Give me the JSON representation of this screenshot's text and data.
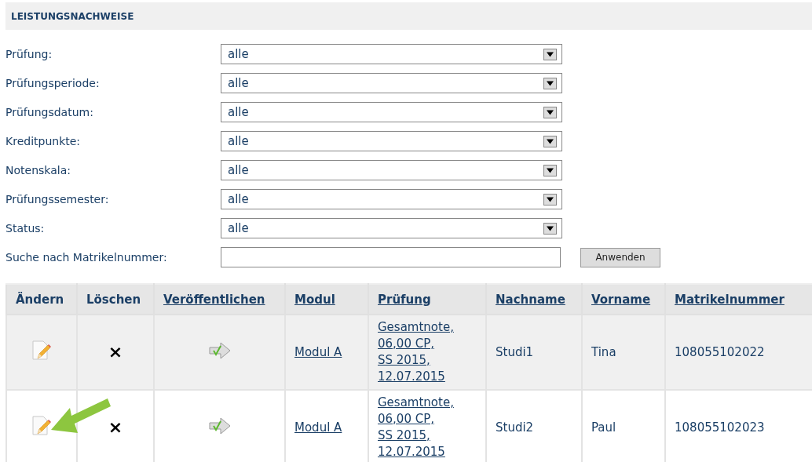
{
  "section_title": "LEISTUNGSNACHWEISE",
  "filters": [
    {
      "label": "Prüfung:",
      "value": "alle"
    },
    {
      "label": "Prüfungsperiode:",
      "value": "alle"
    },
    {
      "label": "Prüfungsdatum:",
      "value": "alle"
    },
    {
      "label": "Kreditpunkte:",
      "value": "alle"
    },
    {
      "label": "Notenskala:",
      "value": "alle"
    },
    {
      "label": "Prüfungssemester:",
      "value": "alle"
    },
    {
      "label": "Status:",
      "value": "alle"
    }
  ],
  "search": {
    "label": "Suche nach Matrikelnummer:",
    "apply_button": "Anwenden"
  },
  "table": {
    "columns": [
      {
        "label": "Ändern",
        "sortable": false
      },
      {
        "label": "Löschen",
        "sortable": false
      },
      {
        "label": "Veröffentlichen",
        "sortable": true
      },
      {
        "label": "Modul",
        "sortable": true
      },
      {
        "label": "Prüfung",
        "sortable": true
      },
      {
        "label": "Nachname",
        "sortable": true
      },
      {
        "label": "Vorname",
        "sortable": true
      },
      {
        "label": "Matrikelnummer",
        "sortable": true
      }
    ],
    "rows": [
      {
        "delete": "×",
        "modul": "Modul A",
        "pruefung": [
          "Gesamtnote,",
          "06,00 CP,",
          "SS 2015,",
          "12.07.2015"
        ],
        "nachname": "Studi1",
        "vorname": "Tina",
        "matrikelnummer": "108055102022",
        "pointed_at": false
      },
      {
        "delete": "×",
        "modul": "Modul A",
        "pruefung": [
          "Gesamtnote,",
          "06,00 CP,",
          "SS 2015,",
          "12.07.2015"
        ],
        "nachname": "Studi2",
        "vorname": "Paul",
        "matrikelnummer": "108055102023",
        "pointed_at": true
      }
    ]
  }
}
